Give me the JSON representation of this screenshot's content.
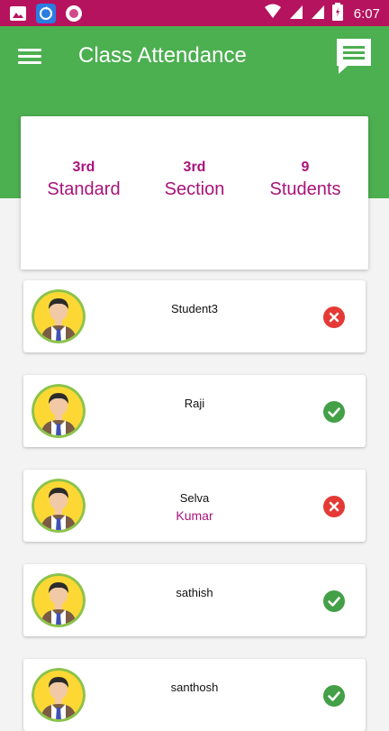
{
  "status_bar": {
    "time": "6:07",
    "color": "#b5135e"
  },
  "app_bar": {
    "title": "Class Attendance",
    "menu_icon": "hamburger-menu-icon",
    "chat_icon": "chat-message-icon",
    "color": "#4caf50"
  },
  "summary": {
    "standard": {
      "value": "3rd",
      "label": "Standard"
    },
    "section": {
      "value": "3rd",
      "label": "Section"
    },
    "students": {
      "value": "9",
      "label": "Students"
    },
    "accent_color": "#a8137a"
  },
  "students": [
    {
      "name": "Student3",
      "second_name": "",
      "status": "absent",
      "status_icon": "cross-circle-icon"
    },
    {
      "name": "Raji",
      "second_name": "",
      "status": "present",
      "status_icon": "check-circle-icon"
    },
    {
      "name": "Selva",
      "second_name": "Kumar",
      "status": "absent",
      "status_icon": "cross-circle-icon"
    },
    {
      "name": "sathish",
      "second_name": "",
      "status": "present",
      "status_icon": "check-circle-icon"
    },
    {
      "name": "santhosh",
      "second_name": "",
      "status": "present",
      "status_icon": "check-circle-icon"
    }
  ],
  "colors": {
    "present": "#43a047",
    "absent": "#e53935"
  }
}
